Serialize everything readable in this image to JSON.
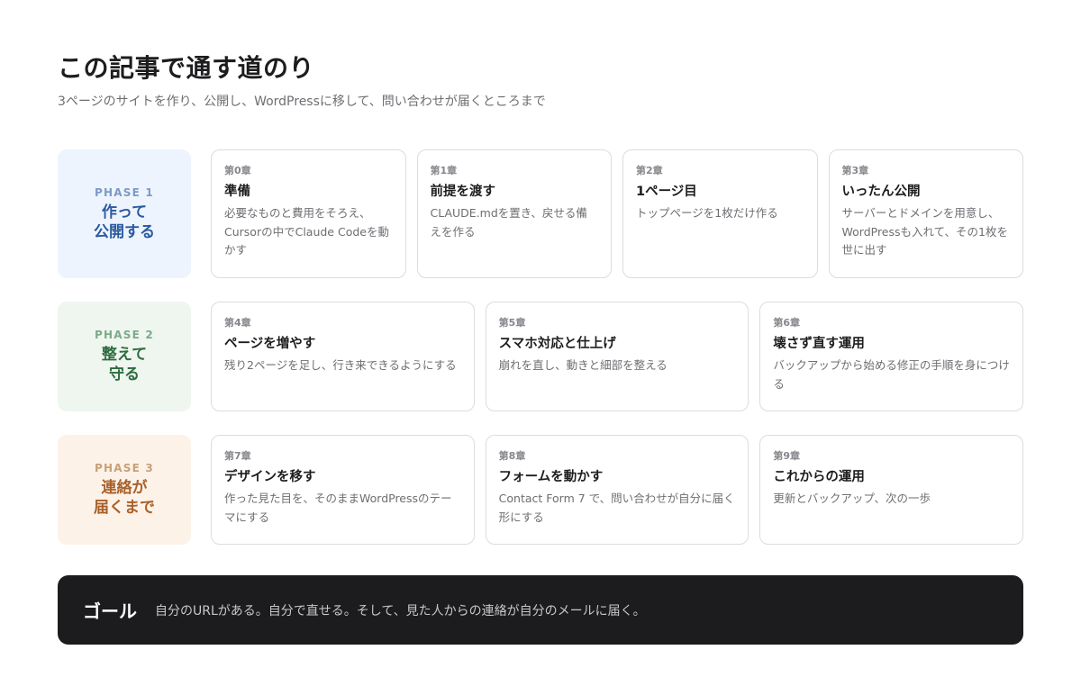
{
  "header": {
    "title": "この記事で通す道のり",
    "subtitle": "3ページのサイトを作り、公開し、WordPressに移して、問い合わせが届くところまで"
  },
  "phases": [
    {
      "label": "PHASE 1",
      "title_line1": "作って",
      "title_line2": "公開する",
      "chapters": [
        {
          "chapter": "第0章",
          "title": "準備",
          "desc": "必要なものと費用をそろえ、Cursorの中でClaude Codeを動かす"
        },
        {
          "chapter": "第1章",
          "title": "前提を渡す",
          "desc": "CLAUDE.mdを置き、戻せる備えを作る"
        },
        {
          "chapter": "第2章",
          "title": "1ページ目",
          "desc": "トップページを1枚だけ作る"
        },
        {
          "chapter": "第3章",
          "title": "いったん公開",
          "desc": "サーバーとドメインを用意し、WordPressも入れて、その1枚を世に出す"
        }
      ]
    },
    {
      "label": "PHASE 2",
      "title_line1": "整えて",
      "title_line2": "守る",
      "chapters": [
        {
          "chapter": "第4章",
          "title": "ページを増やす",
          "desc": "残り2ページを足し、行き来できるようにする"
        },
        {
          "chapter": "第5章",
          "title": "スマホ対応と仕上げ",
          "desc": "崩れを直し、動きと細部を整える"
        },
        {
          "chapter": "第6章",
          "title": "壊さず直す運用",
          "desc": "バックアップから始める修正の手順を身につける"
        }
      ]
    },
    {
      "label": "PHASE 3",
      "title_line1": "連絡が",
      "title_line2": "届くまで",
      "chapters": [
        {
          "chapter": "第7章",
          "title": "デザインを移す",
          "desc": "作った見た目を、そのままWordPressのテーマにする"
        },
        {
          "chapter": "第8章",
          "title": "フォームを動かす",
          "desc": "Contact Form 7 で、問い合わせが自分に届く形にする"
        },
        {
          "chapter": "第9章",
          "title": "これからの運用",
          "desc": "更新とバックアップ、次の一歩"
        }
      ]
    }
  ],
  "goal": {
    "label": "ゴール",
    "text": "自分のURLがある。自分で直せる。そして、見た人からの連絡が自分のメールに届く。"
  }
}
